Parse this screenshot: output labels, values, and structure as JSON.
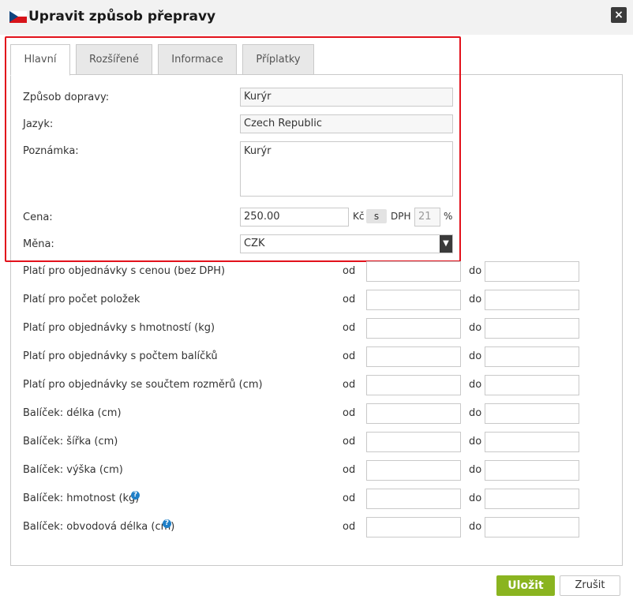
{
  "dialog": {
    "title": "Upravit způsob přepravy",
    "close_icon": "×"
  },
  "tabs": [
    {
      "label": "Hlavní",
      "active": true
    },
    {
      "label": "Rozšířené",
      "active": false
    },
    {
      "label": "Informace",
      "active": false
    },
    {
      "label": "Příplatky",
      "active": false
    }
  ],
  "form": {
    "shipping_method": {
      "label": "Způsob dopravy:",
      "value": "Kurýr"
    },
    "language": {
      "label": "Jazyk:",
      "value": "Czech Republic"
    },
    "note": {
      "label": "Poznámka:",
      "value": "Kurýr"
    },
    "price": {
      "label": "Cena:",
      "value": "250.00",
      "currency_symbol": "Kč",
      "vat_toggle": "s",
      "vat_label": "DPH",
      "vat_value": "21",
      "percent": "%"
    },
    "currency": {
      "label": "Měna:",
      "value": "CZK"
    }
  },
  "range_labels": {
    "from": "od",
    "to": "do"
  },
  "ranges": [
    {
      "label": "Platí pro objednávky s cenou (bez DPH)",
      "from": "",
      "to": "",
      "help": false
    },
    {
      "label": "Platí pro počet položek",
      "from": "",
      "to": "",
      "help": false
    },
    {
      "label": "Platí pro objednávky s hmotností (kg)",
      "from": "",
      "to": "",
      "help": false
    },
    {
      "label": "Platí pro objednávky s počtem balíčků",
      "from": "",
      "to": "",
      "help": false
    },
    {
      "label": "Platí pro objednávky se součtem rozměrů (cm)",
      "from": "",
      "to": "",
      "help": false
    },
    {
      "label": "Balíček: délka (cm)",
      "from": "",
      "to": "",
      "help": false
    },
    {
      "label": "Balíček: šířka (cm)",
      "from": "",
      "to": "",
      "help": false
    },
    {
      "label": "Balíček: výška (cm)",
      "from": "",
      "to": "",
      "help": false
    },
    {
      "label": "Balíček: hmotnost (kg)",
      "from": "",
      "to": "",
      "help": true
    },
    {
      "label": "Balíček: obvodová délka (cm)",
      "from": "",
      "to": "",
      "help": true
    }
  ],
  "buttons": {
    "save": "Uložit",
    "cancel": "Zrušit"
  },
  "colors": {
    "accent_green": "#8ab420",
    "highlight_red": "#e2111b",
    "help_blue": "#1f7fc7"
  }
}
